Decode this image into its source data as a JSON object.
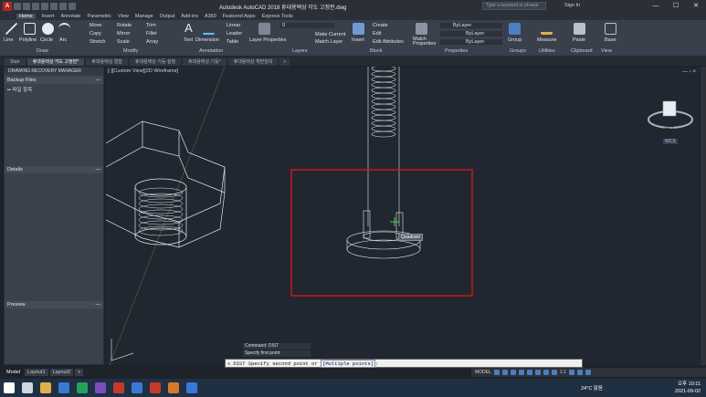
{
  "window": {
    "title": "Autodesk AutoCAD 2018    휴대용택상 각도 고정판.dwg",
    "search_placeholder": "Type a keyword or phrase",
    "signin": "Sign In",
    "controls": [
      "—",
      "☐",
      "✕"
    ]
  },
  "ribbon_tabs": [
    "Home",
    "Insert",
    "Annotate",
    "Parametric",
    "View",
    "Manage",
    "Output",
    "Add-ins",
    "A360",
    "Featured Apps",
    "Express Tools"
  ],
  "ribbon_active_tab": "Home",
  "ribbon": {
    "draw": {
      "label": "Draw",
      "items": [
        "Line",
        "Polyline",
        "Circle",
        "Arc"
      ]
    },
    "modify": {
      "label": "Modify",
      "items": [
        "Move",
        "Rotate",
        "Trim",
        "Copy",
        "Mirror",
        "Fillet",
        "Stretch",
        "Scale",
        "Array"
      ]
    },
    "annotation": {
      "label": "Annotation",
      "items": [
        "Text",
        "Dimension",
        "Linear",
        "Leader",
        "Table"
      ]
    },
    "layers": {
      "label": "Layers",
      "items": [
        "Layer Properties",
        "Make Current",
        "Match Layer"
      ],
      "current_layer": "0"
    },
    "block": {
      "label": "Block",
      "items": [
        "Insert",
        "Create",
        "Edit",
        "Edit Attributes"
      ]
    },
    "properties": {
      "label": "Properties",
      "items": [
        "Match Properties"
      ],
      "values": [
        "ByLayer",
        "ByLayer",
        "ByLayer"
      ]
    },
    "groups": {
      "label": "Groups",
      "items": [
        "Group"
      ]
    },
    "utilities": {
      "label": "Utilities",
      "items": [
        "Measure"
      ]
    },
    "clipboard": {
      "label": "Clipboard",
      "items": [
        "Paste"
      ]
    },
    "view": {
      "label": "View",
      "items": [
        "Base"
      ]
    }
  },
  "doc_tabs": [
    "Start",
    "휴대용택상 각도 고정판*",
    "휴대용택상 결합",
    "휴대용택상 기둥 설정",
    "휴대용택상 기둥*",
    "휴대용택상 책받침대"
  ],
  "doc_active_tab": "휴대용택상 각도 고정판*",
  "recovery": {
    "title": "DRAWING RECOVERY MANAGER",
    "backup_label": "Backup Files",
    "file": "파일 항목",
    "details_label": "Details",
    "preview_label": "Preview"
  },
  "viewport": {
    "label": "[-][Custom View][2D Wireframe]",
    "tooltip": "Quadrant",
    "viewcube_label": "FRT",
    "wcs": "WCS",
    "minmax": "— ▫ ×"
  },
  "command": {
    "history": [
      "Command: DIST",
      "Specify first point:"
    ],
    "prompt": "DIST Specify second point or ",
    "option": "[Multiple points]",
    "suffix": ":"
  },
  "layout_tabs": [
    "Model",
    "Layout1",
    "Layout2",
    "+"
  ],
  "layout_active": "Model",
  "status": {
    "model": "MODEL",
    "scale": "1:1"
  },
  "taskbar": {
    "weather": "24°C 맑음",
    "time": "오후 10:11",
    "date": "2021-09-02",
    "lang": "A",
    "icon_colors": [
      "#fff",
      "#cfd6df",
      "#e0b04a",
      "#3a78d8",
      "#22a35a",
      "#7c4dbd",
      "#c53a2b",
      "#3a78d8",
      "#c53a2b",
      "#d67a2a",
      "#3a78d8"
    ]
  },
  "colors": {
    "accent": "#4a7fc1",
    "highlight_box": "#d4161d",
    "model_lines": "#e4e8ee"
  }
}
